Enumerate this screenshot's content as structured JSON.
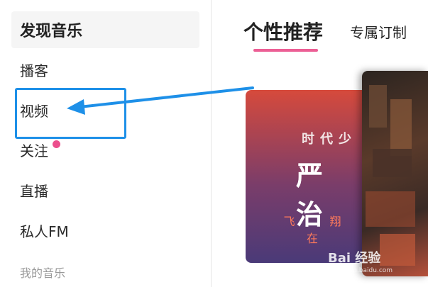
{
  "sidebar": {
    "items": [
      {
        "label": "发现音乐",
        "active": true
      },
      {
        "label": "播客"
      },
      {
        "label": "视频"
      },
      {
        "label": "关注",
        "has_dot": true
      },
      {
        "label": "直播"
      },
      {
        "label": "私人FM"
      }
    ],
    "section_title": "我的音乐"
  },
  "tabs": [
    {
      "label": "个性推荐",
      "active": true
    },
    {
      "label": "专属订制"
    }
  ],
  "card": {
    "line1": "时代少",
    "line2": "严 治",
    "line3": "飞 翔 在"
  },
  "watermark": {
    "text": "Bai 经验",
    "sub": "jingyan.baidu.com"
  },
  "colors": {
    "accent": "#ec5f95",
    "annotation": "#1e90e8"
  }
}
